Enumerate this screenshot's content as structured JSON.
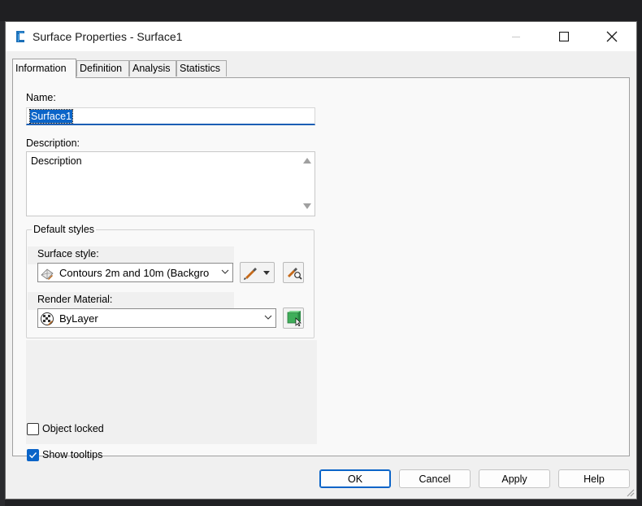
{
  "window": {
    "title": "Surface Properties - Surface1",
    "controls": [
      "minimize-icon",
      "maximize-icon",
      "close-icon"
    ]
  },
  "tabs": [
    {
      "label": "Information",
      "active": true
    },
    {
      "label": "Definition",
      "active": false
    },
    {
      "label": "Analysis",
      "active": false
    },
    {
      "label": "Statistics",
      "active": false
    }
  ],
  "info": {
    "name_label": "Name:",
    "name_value": "Surface1",
    "description_label": "Description:",
    "description_value": "Description"
  },
  "default_styles": {
    "group_title": "Default styles",
    "surface_style_label": "Surface style:",
    "surface_style_value": "Contours 2m and 10m (Backgro",
    "render_material_label": "Render Material:",
    "render_material_value": "ByLayer"
  },
  "options": {
    "object_locked_label": "Object locked",
    "object_locked": false,
    "show_tooltips_label": "Show tooltips",
    "show_tooltips": true
  },
  "buttons": {
    "ok": "OK",
    "cancel": "Cancel",
    "apply": "Apply",
    "help": "Help"
  },
  "colors": {
    "accent": "#0a64c8",
    "dialog_bg": "#f0f0f0",
    "panel_bg": "#f9f9f9"
  }
}
